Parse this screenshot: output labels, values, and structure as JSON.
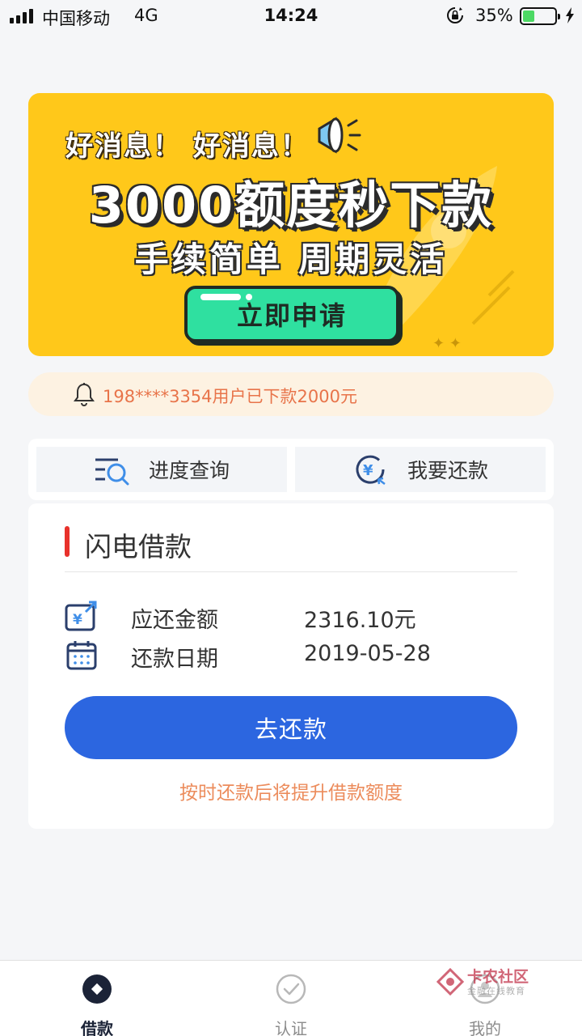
{
  "status_bar": {
    "carrier": "中国移动",
    "network": "4G",
    "time": "14:24",
    "battery_percent": "35%",
    "battery_level": 0.35
  },
  "banner": {
    "kicker": "好消息！ 好消息！",
    "headline": "3000额度秒下款",
    "subheadline": "手续简单 周期灵活",
    "cta_label": "立即申请",
    "background_color": "#ffc81a",
    "cta_color": "#2fe0a0"
  },
  "notice": {
    "text": "198****3354用户已下款2000元",
    "icon": "bell-icon"
  },
  "quick_actions": [
    {
      "label": "进度查询",
      "icon": "progress-search-icon"
    },
    {
      "label": "我要还款",
      "icon": "yuan-repay-icon"
    }
  ],
  "loan_card": {
    "title": "闪电借款",
    "rows": [
      {
        "label": "应还金额",
        "value": "2316.10元",
        "icon": "yuan-card-icon"
      },
      {
        "label": "还款日期",
        "value": "2019-05-28",
        "icon": "calendar-icon"
      }
    ],
    "button_label": "去还款",
    "hint": "按时还款后将提升借款额度",
    "accent_color": "#e8312b",
    "button_color": "#2c66e0"
  },
  "tab_bar": {
    "tabs": [
      {
        "label": "借款",
        "icon": "loan-icon",
        "active": true
      },
      {
        "label": "认证",
        "icon": "check-circle-icon",
        "active": false
      },
      {
        "label": "我的",
        "icon": "profile-icon",
        "active": false
      }
    ]
  },
  "watermark": {
    "title": "卡农社区",
    "subtitle": "金融在线教育"
  }
}
